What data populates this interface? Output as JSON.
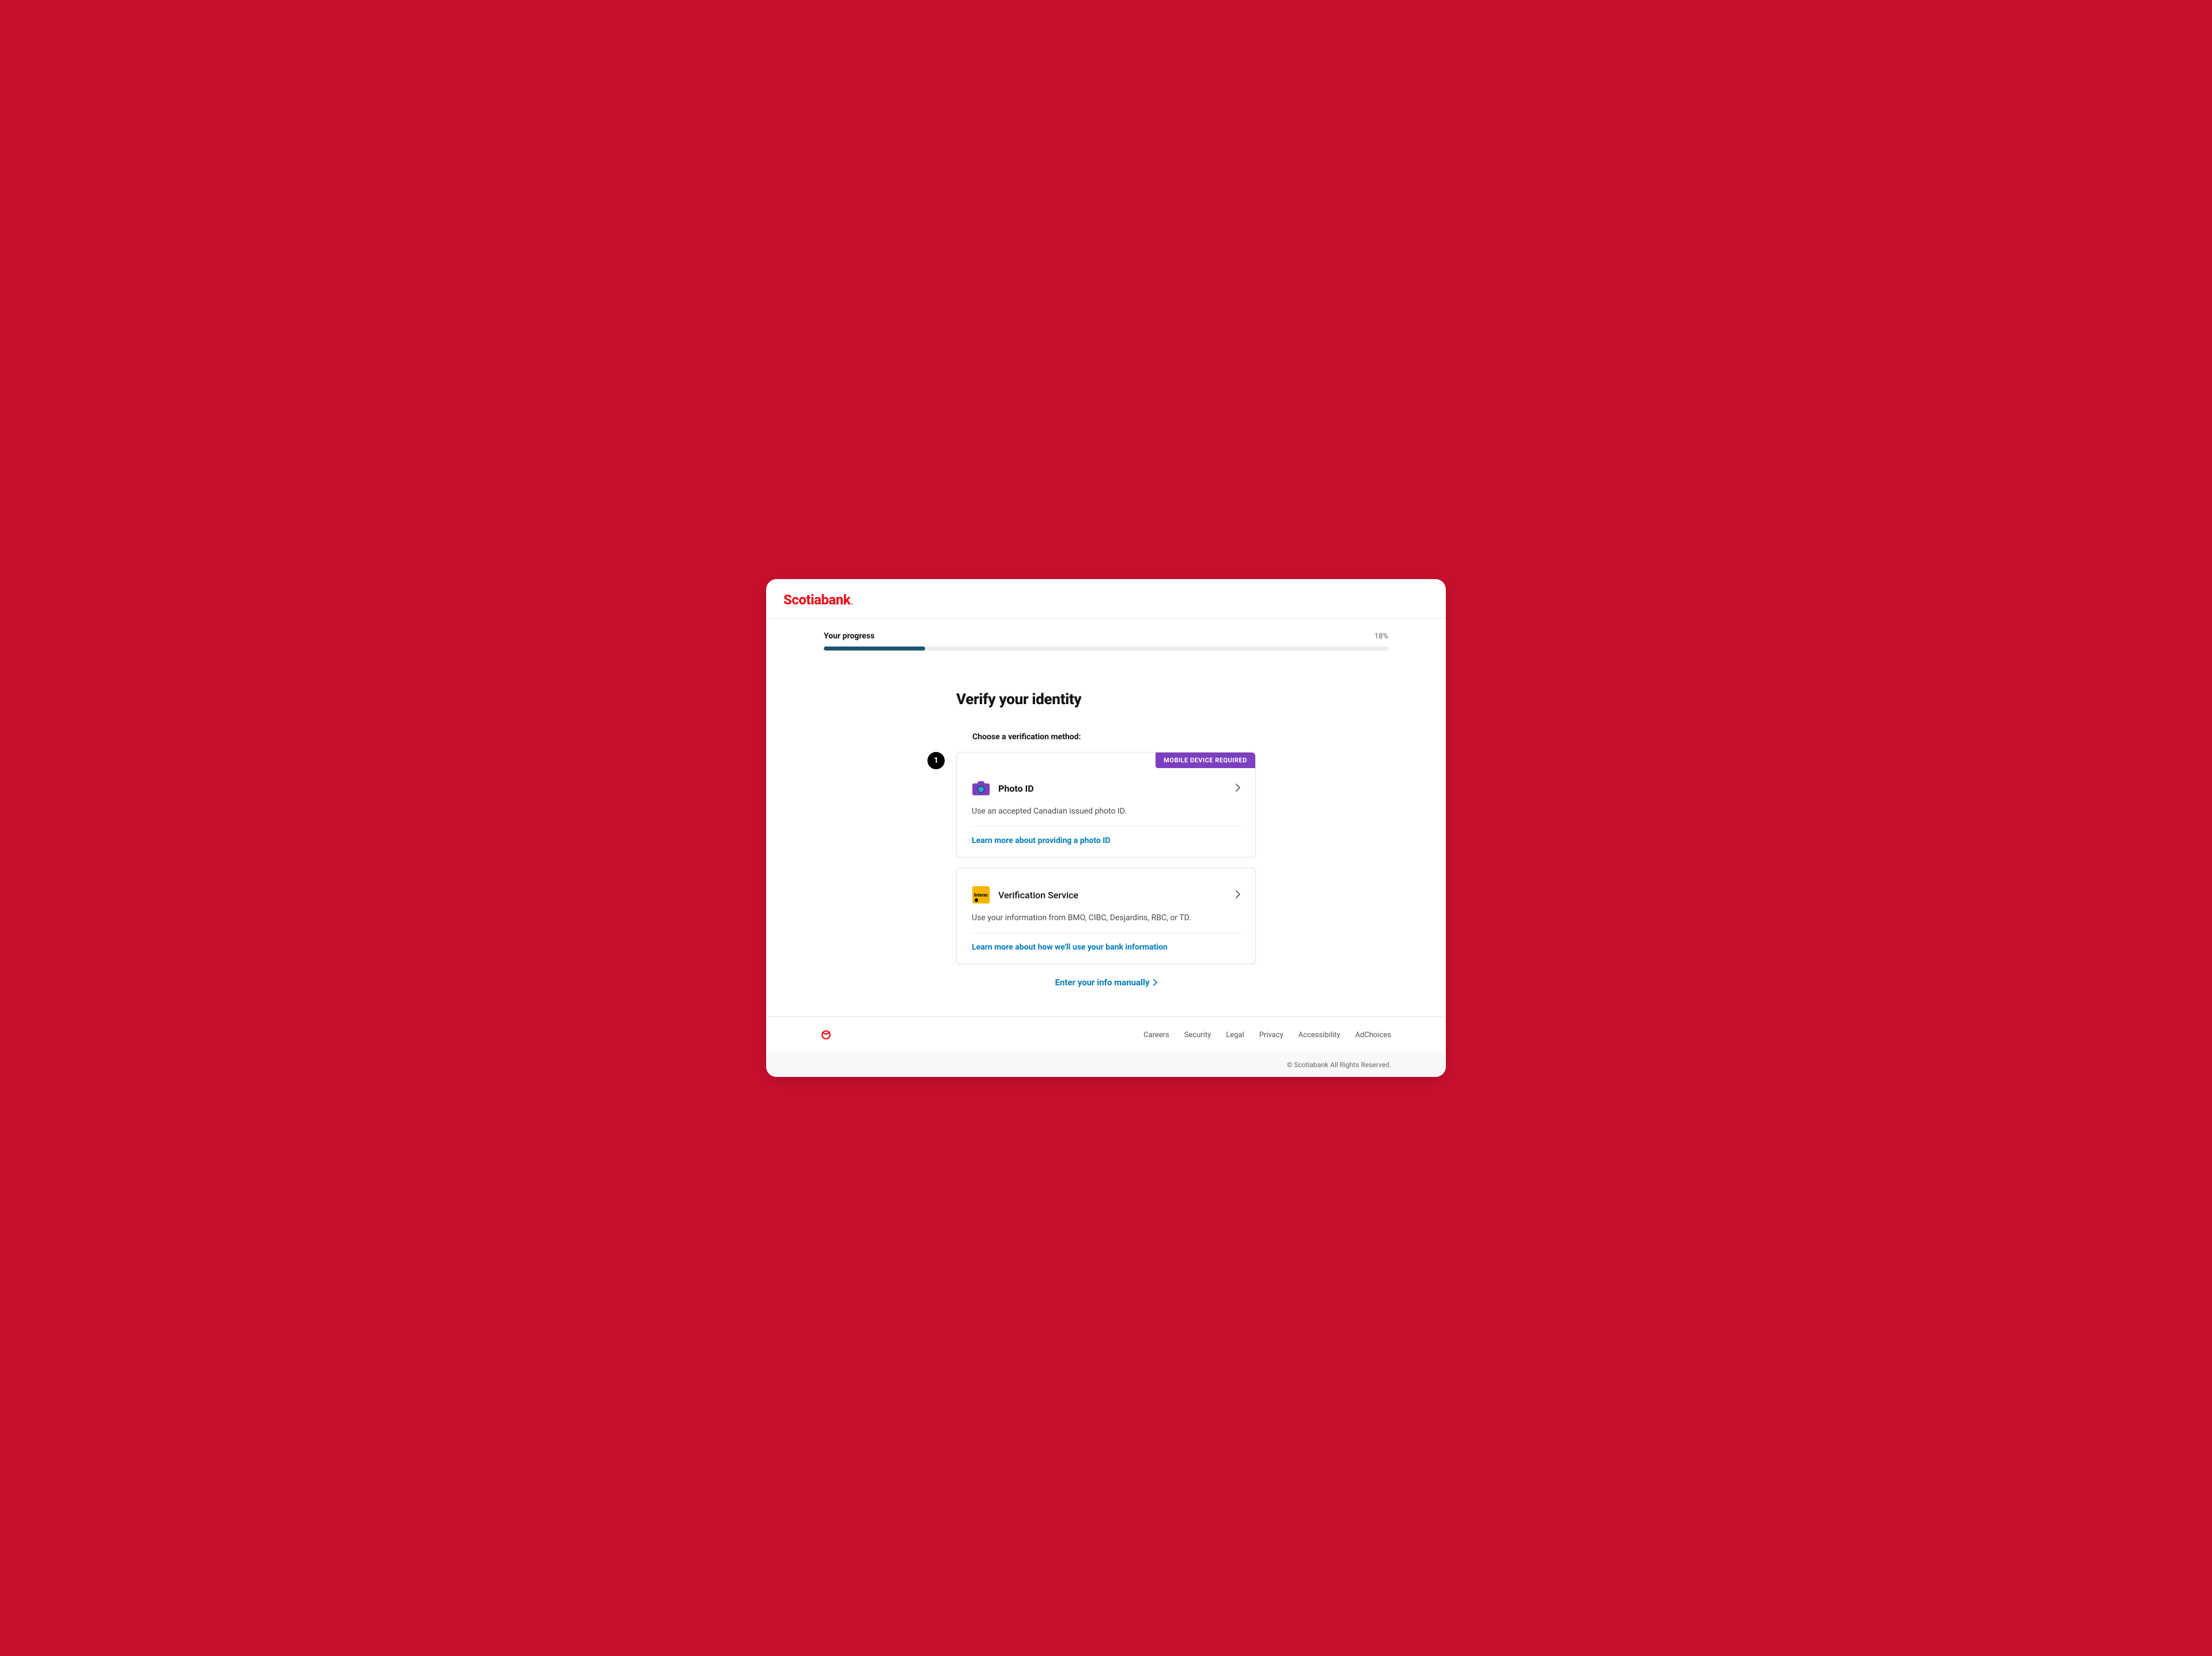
{
  "brand": {
    "name": "Scotiabank",
    "dot": "."
  },
  "progress": {
    "label": "Your progress",
    "percent_label": "18%",
    "percent": 18
  },
  "page": {
    "title": "Verify your identity",
    "subtitle": "Choose a verification method:",
    "callout_number": "1"
  },
  "options": {
    "photo_id": {
      "pill": "MOBILE DEVICE REQUIRED",
      "title": "Photo ID",
      "desc": "Use an accepted Canadian issued photo ID.",
      "learn": "Learn more about providing a photo ID"
    },
    "interac": {
      "logo_text": "Interac",
      "title": "Verification Service",
      "desc": "Use your information from BMO, CIBC, Desjardins, RBC, or TD.",
      "learn": "Learn more about how we'll use your bank information"
    }
  },
  "manual_link": "Enter your info manually",
  "footer": {
    "links": [
      "Careers",
      "Security",
      "Legal",
      "Privacy",
      "Accessibility",
      "AdChoices"
    ],
    "copyright": "© Scotiabank All Rights Reserved."
  },
  "colors": {
    "brand_red": "#c8102e",
    "logo_red": "#ec111a",
    "accent_purple": "#7b3fbf",
    "link_blue": "#007cba",
    "progress_fill": "#1f5570"
  }
}
